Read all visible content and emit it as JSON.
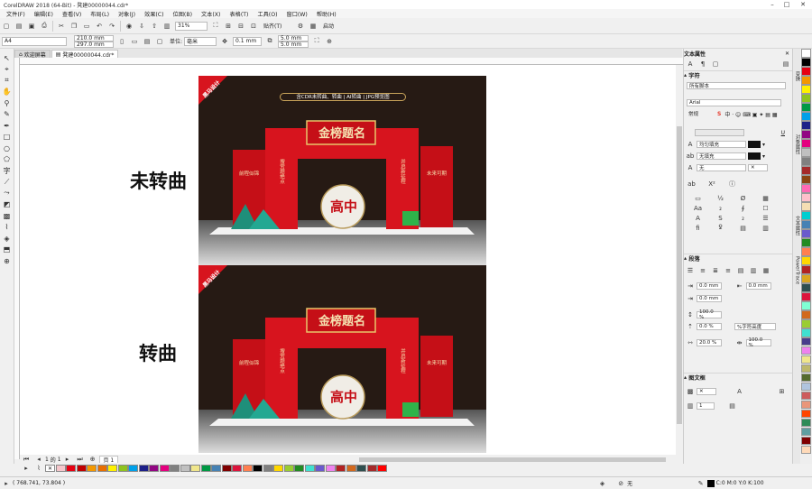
{
  "window": {
    "title": "CorelDRAW 2018 (64-Bit) - 凳建00000044.cdr*"
  },
  "menu": [
    "文件(F)",
    "编辑(E)",
    "查看(V)",
    "布局(L)",
    "对象(J)",
    "效果(C)",
    "位图(B)",
    "文本(X)",
    "表格(T)",
    "工具(O)",
    "窗口(W)",
    "帮助(H)"
  ],
  "toolbar1": {
    "zoom": "31%",
    "snap": "贴齐(T)",
    "launch": "启动"
  },
  "toolbar2": {
    "page_size": "A4",
    "width": "210.0 mm",
    "height": "297.0 mm",
    "unit_label": "单位:",
    "unit": "毫米",
    "nudge": "0.1 mm",
    "dup_x": "5.0 mm",
    "dup_y": "5.0 mm"
  },
  "tabs": [
    {
      "label": "欢迎屏幕"
    },
    {
      "label": "凳建00000044.cdr*"
    }
  ],
  "canvas": {
    "label_top": "未转曲",
    "label_bottom": "转曲",
    "design": {
      "ribbon": "黑马设计",
      "banner": "含CDR未转曲、转曲 | AI转曲 | JPG预览图",
      "sign_title": "金榜题名",
      "left_pillar": "前程似锦",
      "right_pillar": "未来可期",
      "column_left": "搜劳题绝点",
      "column_right": "并启新征程",
      "center": "高中"
    }
  },
  "page_nav": {
    "current": "1",
    "of": "的",
    "total": "1",
    "page_tab": "页 1"
  },
  "panel": {
    "title": "文本属性",
    "section_char": "字符",
    "script": "所有脚本",
    "font": "Arial",
    "style": "常规",
    "fill_uniform": "均匀填充",
    "fill_none": "无填充",
    "outline_none": "无",
    "section_para": "段落",
    "indent_left": "0.0 mm",
    "indent_right": "0.0 mm",
    "indent_first": "0.0 mm",
    "line_spacing": "100.0 %",
    "char_height_unit": "%字符高度",
    "space_before": "0.0 %",
    "char_spacing": "20.0 %",
    "word_spacing": "100.0 %",
    "section_frame": "图文框",
    "columns": "1"
  },
  "side_tabs": [
    "变换",
    "对象属性",
    "文本属性",
    "PowerTrace"
  ],
  "status": {
    "coords": "( 768.741, 73.804 )",
    "fill_none": "无",
    "cmyk": "C:0 M:0 Y:0 K:100"
  },
  "colors": {
    "accent": "#c8102e",
    "art_bg": "#261a14",
    "palette": [
      "#ffffff",
      "#000000",
      "#e60012",
      "#f39800",
      "#fff100",
      "#8fc31f",
      "#009944",
      "#00a0e9",
      "#1d2088",
      "#920783",
      "#e4007f",
      "#c0c0c0",
      "#808080",
      "#a52a2a",
      "#8b4513",
      "#ff69b4",
      "#ffc0cb",
      "#f5deb3",
      "#00ced1",
      "#4682b4",
      "#6a5acd",
      "#228b22",
      "#ff7f50",
      "#ffd700",
      "#b22222",
      "#daa520",
      "#2f4f4f",
      "#dc143c",
      "#7fffd4",
      "#d2691e",
      "#9acd32",
      "#40e0d0",
      "#483d8b",
      "#ee82ee",
      "#f0e68c",
      "#bdb76b",
      "#556b2f",
      "#b0c4de",
      "#cd5c5c",
      "#e9967a",
      "#ff4500",
      "#2e8b57",
      "#5f9ea0",
      "#800000",
      "#ffdab9"
    ],
    "bottom_palette": [
      "#f5c6cb",
      "#e60012",
      "#c00000",
      "#f39800",
      "#e86f00",
      "#fff100",
      "#8fc31f",
      "#00a0e9",
      "#1d2088",
      "#920783",
      "#e4007f",
      "#808080",
      "#c0c0c0",
      "#f0e68c",
      "#009944",
      "#4682b4",
      "#800000",
      "#dc143c",
      "#ff7f50",
      "#000000",
      "#7f7f7f",
      "#ffd700",
      "#9acd32",
      "#228b22",
      "#40e0d0",
      "#6a5acd",
      "#ee82ee",
      "#b22222",
      "#d2691e",
      "#2f4f4f",
      "#a52a2a",
      "#ff0000"
    ]
  }
}
